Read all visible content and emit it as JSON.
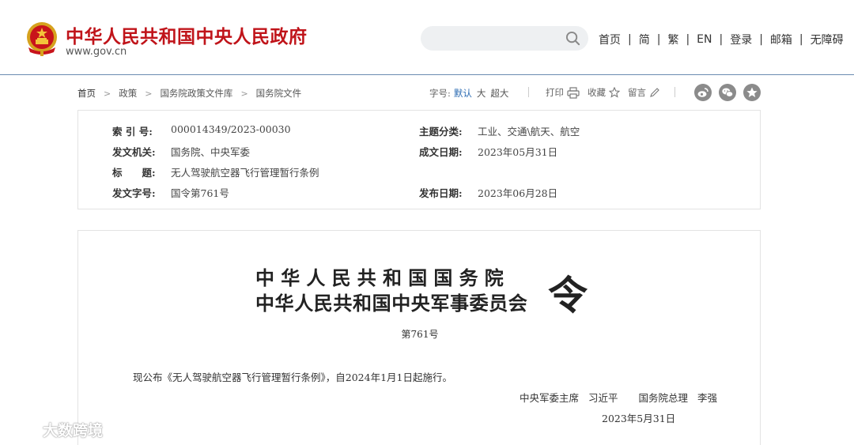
{
  "header": {
    "site_title": "中华人民共和国中央人民政府",
    "site_url": "www.gov.cn",
    "search_placeholder": "",
    "links": [
      "首页",
      "简",
      "繁",
      "EN",
      "登录",
      "邮箱",
      "无障碍"
    ]
  },
  "toolbar": {
    "breadcrumb": [
      "首页",
      "政策",
      "国务院政策文件库",
      "国务院文件"
    ],
    "font_label": "字号:",
    "font_options": [
      "默认",
      "大",
      "超大"
    ],
    "font_active": "默认",
    "tools": [
      "打印",
      "收藏",
      "留言"
    ]
  },
  "info": {
    "index_label": "索 引 号:",
    "index_value": "000014349/2023-00030",
    "topic_label": "主题分类:",
    "topic_value": "工业、交通\\航天、航空",
    "issuer_label": "发文机关:",
    "issuer_value": "国务院、中央军委",
    "created_label": "成文日期:",
    "created_value": "2023年05月31日",
    "title_label": "标　　题:",
    "title_value": "无人驾驶航空器飞行管理暂行条例",
    "docno_label": "发文字号:",
    "docno_value": "国令第761号",
    "published_label": "发布日期:",
    "published_value": "2023年06月28日"
  },
  "content": {
    "decree_line1": "中华人民共和国国务院",
    "decree_line2": "中华人民共和国中央军事委员会",
    "decree_char": "令",
    "decree_number": "第761号",
    "body": "现公布《无人驾驶航空器飞行管理暂行条例》，自2024年1月1日起施行。",
    "signer1_title": "中央军委主席",
    "signer1_name": "习近平",
    "signer2_title": "国务院总理",
    "signer2_name": "李强",
    "sign_date": "2023年5月31日"
  },
  "watermark": {
    "text": "大数跨境"
  },
  "colors": {
    "brand_red": "#c0141a",
    "link_blue": "#2a6ab2",
    "header_border": "#6a8cb0"
  }
}
